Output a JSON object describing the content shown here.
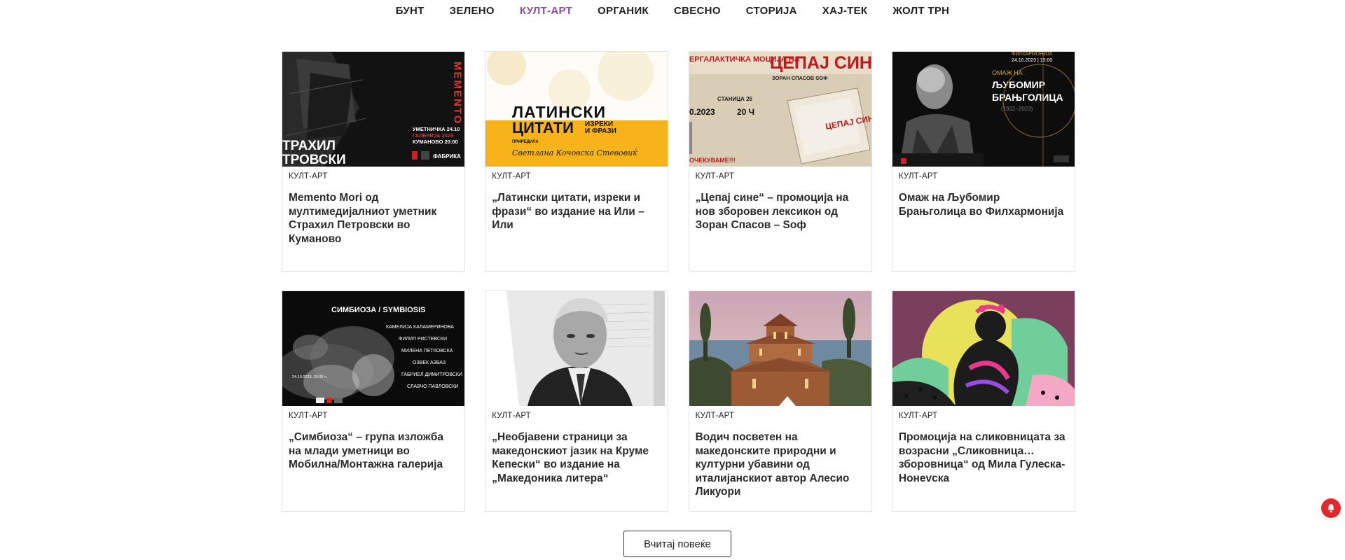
{
  "nav": {
    "items": [
      {
        "label": "БУНТ",
        "active": false
      },
      {
        "label": "ЗЕЛЕНО",
        "active": false
      },
      {
        "label": "КУЛТ-АРТ",
        "active": true
      },
      {
        "label": "ОРГАНИК",
        "active": false
      },
      {
        "label": "СВЕСНО",
        "active": false
      },
      {
        "label": "СТОРИЈА",
        "active": false
      },
      {
        "label": "ХАЈ-ТЕК",
        "active": false
      },
      {
        "label": "ЖОЛТ ТРН",
        "active": false
      }
    ]
  },
  "colors": {
    "accent": "#8a4f97",
    "notification": "#e3282b"
  },
  "cards": [
    {
      "category": "КУЛТ-АРТ",
      "title": "Memento Mori од мултимедијалниот уметник Страхил Петровски во Куманово",
      "thumb": {
        "text_lines": [
          "ТРАХИЛ",
          "ТРОВСКИ"
        ],
        "side_letters": "MEMENTO",
        "info_lines": [
          "УМЕТНИЧКА 24.10",
          "ГАЛЕРИЈА 2023",
          "КУМАНОВО 20:00"
        ],
        "logo": "ФАБРИКА"
      }
    },
    {
      "category": "КУЛТ-АРТ",
      "title": "„Латински цитати, изреки и фрази“ во издание на Или – Или",
      "thumb": {
        "heading_1": "ЛАТИНСКИ",
        "heading_2": "ЦИТАТИ",
        "heading_3": "ИЗРЕКИ",
        "heading_4": "И ФРАЗИ",
        "editor_label": "ПРИРЕДИЛА",
        "signature": "Светлана Кочовска Стевовиќ"
      }
    },
    {
      "category": "КУЛТ-АРТ",
      "title": "„Цепај сине“ – промоција на нов зборовен лексикон од Зоран Спасов – Sоф",
      "thumb": {
        "big_title": "ЦЕПАЈ СИН",
        "left_title": "ЕРГАЛАКТИЧКА МОЦИЈА НА",
        "author": "ЗОРАН СПАСОВ SОФ",
        "date": "0.2023",
        "time": "20 Ч",
        "station": "СТАНИЦА 26",
        "footer": "ОЧЕКУВАМЕ!!!",
        "book": "ЦЕПАЈ СИНЕ"
      }
    },
    {
      "category": "КУЛТ-АРТ",
      "title": "Омаж на Љубомир Брањголица во Филхармонија",
      "thumb": {
        "org": "ФИЛХАРМОНИЈА",
        "date": "24.10.2023 | 19:00",
        "omage": "ОМАЖ НА",
        "name_1": "ЉУБОМИР",
        "name_2": "БРАЊГОЛИЦА",
        "years": "(1932–2023)"
      }
    },
    {
      "category": "КУЛТ-АРТ",
      "title": "„Симбиоза“ – група изложба на млади уметници во Мобилна/Монтажна галерија",
      "thumb": {
        "heading": "СИМБИОЗА / SYMBIOSIS",
        "artists": [
          "КАМЕЛИЈА КАЛАМЕРИНОВА",
          "ФИЛИП РИСТЕВСКИ",
          "МИЛЕНА ПЕТКОВСКА",
          "ОЗВЕК АЗВАЗ",
          "ГАБРИЕЛ ДИМИТРОВСКИ",
          "СЛАВЧО ПАВЛОВСКИ"
        ],
        "date": "24.10.2023, 20:00 ч."
      }
    },
    {
      "category": "КУЛТ-АРТ",
      "title": "„Необјавени страници за македонскиот јазик на Круме Кепески“ во издание на „Македоника литера“",
      "thumb": {}
    },
    {
      "category": "КУЛТ-АРТ",
      "title": "Водич посветен на македонските природни и културни убавини од италијанскиот автор Алесио Ликуори",
      "thumb": {}
    },
    {
      "category": "КУЛТ-АРТ",
      "title": "Промоција на сликовницата за возрасни „Сликовница… зборовница“ од Мила Гулеска-Нонevска",
      "thumb": {}
    }
  ],
  "load_more": {
    "label": "Вчитај повеќе"
  },
  "notification": {
    "icon": "bell-icon"
  }
}
